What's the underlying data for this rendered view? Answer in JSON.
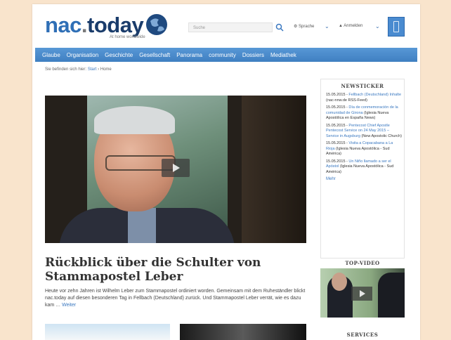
{
  "header": {
    "logo_main": "nac",
    "logo_dot": ".",
    "logo_today": "today",
    "tagline": "At home worldwide",
    "search_placeholder": "Suche",
    "language_label": "Sprache",
    "login_label": "Anmelden",
    "mobile_icon": "mobile-phone-icon"
  },
  "nav": {
    "items": [
      "Glaube",
      "Organisation",
      "Geschichte",
      "Gesellschaft",
      "Panorama",
      "community",
      "Dossiers",
      "Mediathek"
    ]
  },
  "breadcrumb": {
    "prefix": "Sie befinden sich hier:",
    "start": "Start",
    "sep": "›",
    "current": "Home"
  },
  "main": {
    "headline": "Rückblick über die Schulter von Stammapostel Leber",
    "teaser": "Heute vor zehn Jahren ist Wilhelm Leber zum Stammapostel ordiniert worden. Gemeinsam mit dem Ruheständler blickt nac.today auf diesen besonderen Tag in Fellbach (Deutschland) zurück. Und Stammapostel Leber verrät, wie es dazu kam …",
    "more": "Weiter"
  },
  "sidebar": {
    "newsticker_title": "NEWSTICKER",
    "news": [
      {
        "date": "15.05.2015 -",
        "link": "Fellbach (Deutschland) Inhalte",
        "source": "(nac-nnw.de RSS-Feed)"
      },
      {
        "date": "15.05.2015 -",
        "link": "Día de conmemoración de la comunidad de Girona",
        "source": "(Iglesia Nueva Apostólica en España News)"
      },
      {
        "date": "15.05.2015 -",
        "link": "Pentecost Chief Apostle Pentecost Service on 24 May 2015 – Service in Augsburg",
        "source": "(New Apostolic Church)"
      },
      {
        "date": "15.05.2015 -",
        "link": "Visita a Copacabana a La Rioja",
        "source": "(Iglesia Nueva Apostólica - Sud América)"
      },
      {
        "date": "15.05.2015 -",
        "link": "Un Niño llamado a ser el Apóstol",
        "source": "(Iglesia Nueva Apostólica - Sud América)"
      }
    ],
    "more": "Mehr",
    "topvideo_title": "TOP-VIDEO",
    "services_title": "SERVICES"
  }
}
